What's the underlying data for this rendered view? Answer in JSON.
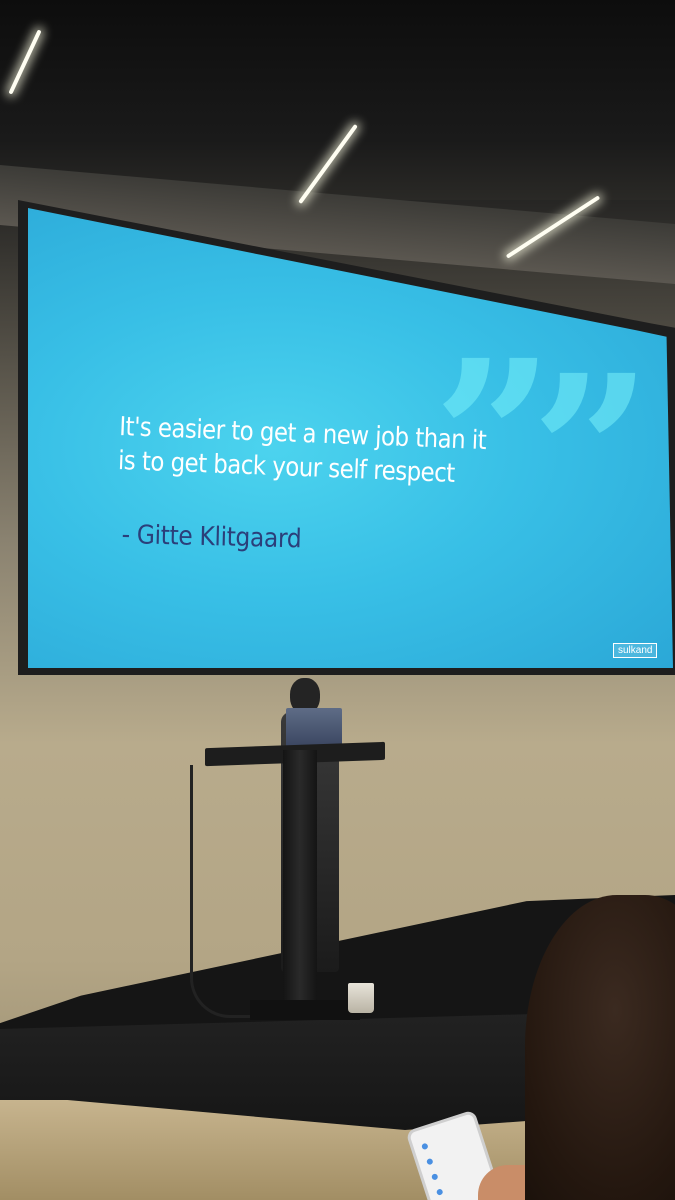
{
  "slide": {
    "quote_line_1": "It's easier to get a new job than it",
    "quote_line_2": "is to get back your self respect",
    "author": "- Gitte Klitgaard",
    "logo": "sulkand",
    "background_color": "#38bfe6",
    "quote_text_color": "#ffffff",
    "author_text_color": "#2b3f7a"
  }
}
